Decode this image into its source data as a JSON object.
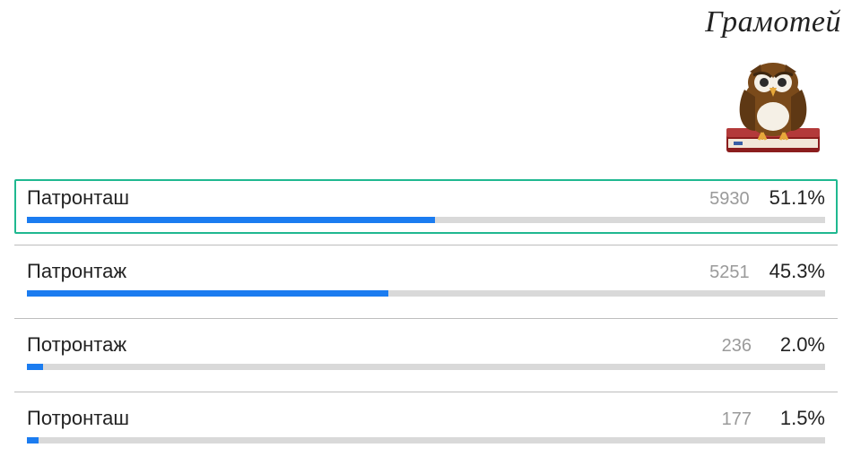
{
  "brand": {
    "title": "Грамотей"
  },
  "chart_data": {
    "type": "bar",
    "title": "Грамотей",
    "categories": [
      "Патронташ",
      "Патронтаж",
      "Потронтаж",
      "Потронташ"
    ],
    "series": [
      {
        "name": "Votes",
        "values": [
          5930,
          5251,
          236,
          177
        ]
      },
      {
        "name": "Percent",
        "values": [
          51.1,
          45.3,
          2.0,
          1.5
        ]
      }
    ],
    "xlabel": "",
    "ylabel": "",
    "ylim": [
      0,
      100
    ]
  },
  "options": [
    {
      "label": "Патронташ",
      "count": "5930",
      "pct": "51.1%",
      "bar": 51.1,
      "highlight": true
    },
    {
      "label": "Патронтаж",
      "count": "5251",
      "pct": "45.3%",
      "bar": 45.3,
      "highlight": false
    },
    {
      "label": "Потронтаж",
      "count": "236",
      "pct": "2.0%",
      "bar": 2.0,
      "highlight": false
    },
    {
      "label": "Потронташ",
      "count": "177",
      "pct": "1.5%",
      "bar": 1.5,
      "highlight": false
    }
  ]
}
